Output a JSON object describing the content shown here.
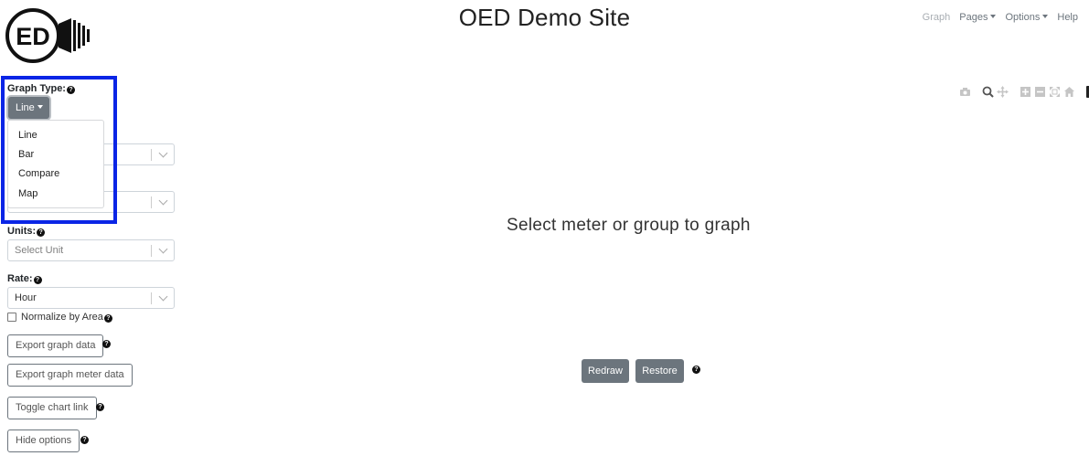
{
  "header": {
    "title": "OED Demo Site",
    "logo_text": "ED",
    "nav": {
      "graph": "Graph",
      "pages": "Pages",
      "options": "Options",
      "help": "Help"
    }
  },
  "sidebar": {
    "graph_type": {
      "label": "Graph Type:",
      "selected": "Line",
      "options": [
        "Line",
        "Bar",
        "Compare",
        "Map"
      ]
    },
    "units": {
      "label": "Units:",
      "placeholder": "Select Unit"
    },
    "rate": {
      "label": "Rate:",
      "value": "Hour"
    },
    "normalize_label": "Normalize by Area",
    "buttons": {
      "export_graph_data": "Export graph data",
      "export_meter_data": "Export graph meter data",
      "toggle_chart_link": "Toggle chart link",
      "hide_options": "Hide options"
    }
  },
  "main": {
    "empty_message": "Select meter or group to graph",
    "redraw": "Redraw",
    "restore": "Restore"
  },
  "modebar_icons": [
    "camera-icon",
    "zoom-icon",
    "pan-icon",
    "zoom-in-icon",
    "zoom-out-icon",
    "autoscale-icon",
    "reset-axes-icon",
    "plotly-logo-icon"
  ],
  "colors": {
    "highlight": "#0a25e6",
    "secondary_button": "#6c757d"
  }
}
